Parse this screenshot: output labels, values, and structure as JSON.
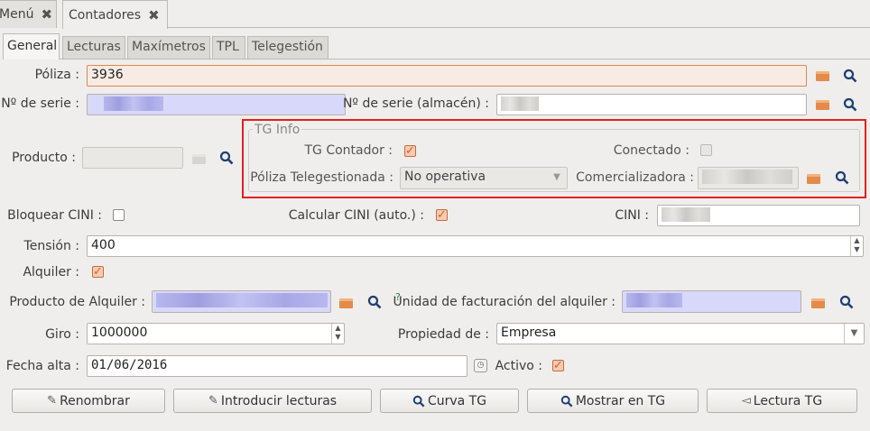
{
  "doc_tabs": [
    {
      "label": "Menú",
      "close_icon": "close-icon"
    },
    {
      "label": "Contadores",
      "close_icon": "close-icon"
    }
  ],
  "form_tabs": [
    "General",
    "Lecturas",
    "Maxímetros",
    "TPL",
    "Telegestión"
  ],
  "fields": {
    "poliza": {
      "label": "Póliza :",
      "value": "3936"
    },
    "n_serie": {
      "label": "Nº de serie :"
    },
    "n_serie_almacen": {
      "label": "Nº de serie (almacén) :"
    },
    "producto": {
      "label": "Producto :"
    },
    "tg_info": {
      "title": "TG Info",
      "tg_contador": {
        "label": "TG Contador :",
        "checked": true
      },
      "conectado": {
        "label": "Conectado :",
        "checked": false
      },
      "poliza_telegestionada": {
        "label": "Póliza Telegestionada :",
        "value": "No operativa"
      },
      "comercializadora": {
        "label": "Comercializadora :"
      }
    },
    "bloquear_cini": {
      "label": "Bloquear CINI :",
      "checked": false
    },
    "calcular_cini": {
      "label": "Calcular CINI (auto.) :",
      "checked": true
    },
    "cini": {
      "label": "CINI :"
    },
    "tension": {
      "label": "Tensión :",
      "value": "400"
    },
    "alquiler": {
      "label": "Alquiler :",
      "checked": true
    },
    "producto_alquiler": {
      "label": "Producto de Alquiler :"
    },
    "unidad_facturacion": {
      "label": "Unidad de facturación del alquiler :",
      "help_mark": "?"
    },
    "giro": {
      "label": "Giro :",
      "value": "1000000"
    },
    "propiedad": {
      "label": "Propiedad de :",
      "value": "Empresa"
    },
    "fecha_alta": {
      "label": "Fecha alta :",
      "value": "01/06/2016"
    },
    "activo": {
      "label": "Activo :",
      "checked": true
    }
  },
  "buttons": [
    {
      "label": "Renombrar",
      "icon": "pencil-icon"
    },
    {
      "label": "Introducir lecturas",
      "icon": "pencil-icon"
    },
    {
      "label": "Curva TG",
      "icon": "search-icon"
    },
    {
      "label": "Mostrar en TG",
      "icon": "search-icon"
    },
    {
      "label": "Lectura TG",
      "icon": "meter-icon"
    }
  ],
  "colors": {
    "accent": "#e05c21",
    "highlight_box": "#e32020",
    "required_field": "#d8d8fb"
  }
}
